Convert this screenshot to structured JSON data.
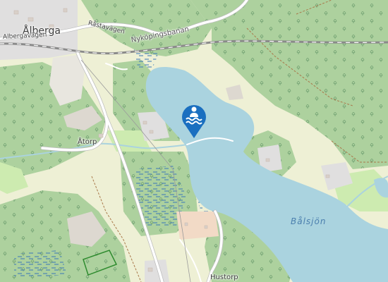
{
  "map": {
    "labels": {
      "alberga": "Ålberga",
      "albergavagen": "Albergavägen",
      "rastavagen": "Råstavägen",
      "nykopingsbanan": "Nyköpingsbanan",
      "atorp": "Åtorp",
      "balsjon": "Bålsjön",
      "hustorp": "Hustorp"
    },
    "marker": {
      "icon": "swimming-icon",
      "color": "#1a6fc0"
    },
    "colors": {
      "water": "#aad3df",
      "forest": "#8fbc8f",
      "farmland": "#eef0d5",
      "meadow": "#cdebb0",
      "residential": "#e0dfdf",
      "rock": "#ddd8d0",
      "railway": "#999999",
      "road": "#ffffff"
    }
  }
}
